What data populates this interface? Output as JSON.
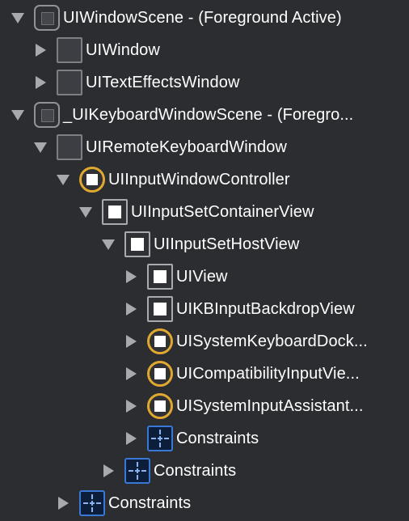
{
  "colors": {
    "background": "#2b2d31",
    "text": "#ffffff",
    "disclosure": "#a7a9ad",
    "controller_ring": "#e0a82e",
    "constraints_blue": "#3a78d8"
  },
  "tree": [
    {
      "label": "UIWindowScene - (Foreground Active)",
      "icon": "scene-icon",
      "state": "expanded",
      "level": 0
    },
    {
      "label": "UIWindow",
      "icon": "window-icon",
      "state": "collapsed",
      "level": 1
    },
    {
      "label": "UITextEffectsWindow",
      "icon": "window-icon",
      "state": "collapsed",
      "level": 1
    },
    {
      "label": "_UIKeyboardWindowScene - (Foregro...",
      "icon": "scene-icon",
      "state": "expanded",
      "level": 0
    },
    {
      "label": "UIRemoteKeyboardWindow",
      "icon": "window-icon",
      "state": "expanded",
      "level": 1
    },
    {
      "label": "UIInputWindowController",
      "icon": "view-controller-icon",
      "state": "expanded",
      "level": 2
    },
    {
      "label": "UIInputSetContainerView",
      "icon": "view-icon",
      "state": "expanded",
      "level": 3
    },
    {
      "label": "UIInputSetHostView",
      "icon": "view-icon",
      "state": "expanded",
      "level": 4
    },
    {
      "label": "UIView",
      "icon": "view-icon",
      "state": "collapsed",
      "level": 5
    },
    {
      "label": "UIKBInputBackdropView",
      "icon": "view-icon",
      "state": "collapsed",
      "level": 5
    },
    {
      "label": "UISystemKeyboardDock...",
      "icon": "view-controller-icon",
      "state": "collapsed",
      "level": 5
    },
    {
      "label": "UICompatibilityInputVie...",
      "icon": "view-controller-icon",
      "state": "collapsed",
      "level": 5
    },
    {
      "label": "UISystemInputAssistant...",
      "icon": "view-controller-icon",
      "state": "collapsed",
      "level": 5
    },
    {
      "label": "Constraints",
      "icon": "constraints-icon",
      "state": "collapsed",
      "level": 5
    },
    {
      "label": "Constraints",
      "icon": "constraints-icon",
      "state": "collapsed",
      "level": 4
    },
    {
      "label": "Constraints",
      "icon": "constraints-icon",
      "state": "collapsed",
      "level": 2
    }
  ]
}
